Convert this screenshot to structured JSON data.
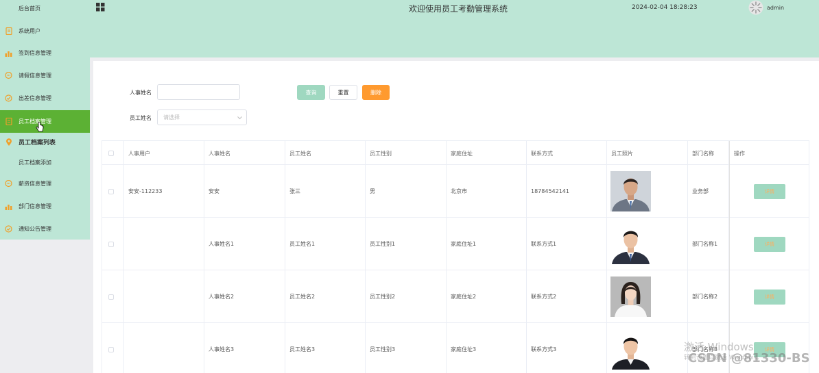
{
  "sidebar": {
    "items": [
      {
        "label": "后台首页",
        "icon": "home-icon"
      },
      {
        "label": "系统用户",
        "icon": "document-icon"
      },
      {
        "label": "签到信息管理",
        "icon": "bar-chart-icon"
      },
      {
        "label": "请假信息管理",
        "icon": "chat-icon"
      },
      {
        "label": "出差信息管理",
        "icon": "check-circle-icon"
      },
      {
        "label": "员工档案管理",
        "icon": "document-icon"
      },
      {
        "label": "员工档案列表",
        "icon": "location-pin-icon"
      },
      {
        "label": "员工档案添加",
        "icon": ""
      },
      {
        "label": "薪资信息管理",
        "icon": "chat-icon"
      },
      {
        "label": "部门信息管理",
        "icon": "bar-chart-icon"
      },
      {
        "label": "通知公告管理",
        "icon": "check-circle-icon"
      }
    ]
  },
  "header": {
    "title": "欢迎使用员工考勤管理系统",
    "datetime": "2024-02-04 18:28:23",
    "username": "admin"
  },
  "filters": {
    "hr_name_label": "人事姓名",
    "hr_name_value": "",
    "employee_name_label": "员工姓名",
    "employee_name_placeholder": "请选择"
  },
  "buttons": {
    "query": "查询",
    "reset": "重置",
    "delete": "删除",
    "detail": "详情"
  },
  "table": {
    "columns": [
      "人事用户",
      "人事姓名",
      "员工姓名",
      "员工性别",
      "家庭住址",
      "联系方式",
      "员工照片",
      "部门名称",
      "操作"
    ],
    "rows": [
      {
        "hr_user": "安安-112233",
        "hr_name": "安安",
        "employee_name": "张三",
        "gender": "男",
        "address": "北京市",
        "contact": "18784542141",
        "department": "业务部"
      },
      {
        "hr_user": "",
        "hr_name": "人事姓名1",
        "employee_name": "员工姓名1",
        "gender": "员工性别1",
        "address": "家庭住址1",
        "contact": "联系方式1",
        "department": "部门名称1"
      },
      {
        "hr_user": "",
        "hr_name": "人事姓名2",
        "employee_name": "员工姓名2",
        "gender": "员工性别2",
        "address": "家庭住址2",
        "contact": "联系方式2",
        "department": "部门名称2"
      },
      {
        "hr_user": "",
        "hr_name": "人事姓名3",
        "employee_name": "员工姓名3",
        "gender": "员工性别3",
        "address": "家庭住址3",
        "contact": "联系方式3",
        "department": "部门名称3"
      }
    ]
  },
  "watermark": {
    "windows": "激活 Windows",
    "windows_sub": "转到设置以激活 Windows。",
    "csdn": "CSDN @81330-BS"
  },
  "colors": {
    "sidebar_bg": "#bde6d6",
    "active_bg": "#5cb134",
    "icon_orange": "#f0a02a",
    "query_btn": "#9fd8c0",
    "delete_btn": "#ff9a2f"
  }
}
